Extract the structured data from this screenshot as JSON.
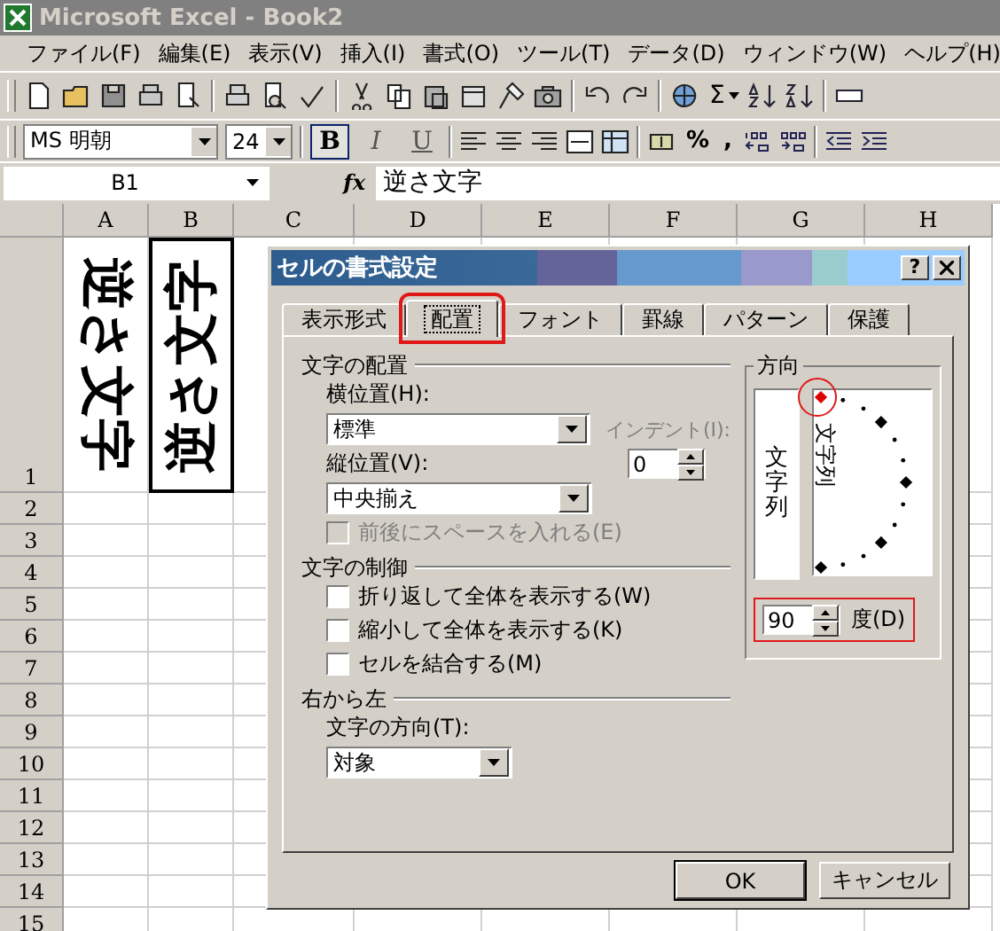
{
  "window": {
    "title": "Microsoft Excel - Book2"
  },
  "menu": [
    "ファイル(F)",
    "編集(E)",
    "表示(V)",
    "挿入(I)",
    "書式(O)",
    "ツール(T)",
    "データ(D)",
    "ウィンドウ(W)",
    "ヘルプ(H)"
  ],
  "standard_toolbar": {
    "sum_symbol": "Σ"
  },
  "format_toolbar": {
    "font_name": "MS 明朝",
    "font_size": "24",
    "style_buttons": [
      {
        "label": "B",
        "selected": true
      },
      {
        "label": "I",
        "selected": false
      },
      {
        "label": "U",
        "selected": false
      }
    ],
    "symbols": [
      "%",
      ","
    ]
  },
  "formula_bar": {
    "name_box": "B1",
    "fx": "fx",
    "formula": "逆さ文字"
  },
  "sheet": {
    "columns": [
      "A",
      "B",
      "C",
      "D",
      "E",
      "F",
      "G",
      "H"
    ],
    "rows": [
      {
        "label": "1",
        "cells": [
          {
            "text": "逆さ文字",
            "kind": "down",
            "selected": false
          },
          {
            "text": "逆さ文字",
            "kind": "up",
            "selected": true
          }
        ]
      },
      {
        "label": "2"
      },
      {
        "label": "3"
      },
      {
        "label": "4"
      },
      {
        "label": "5"
      },
      {
        "label": "6"
      },
      {
        "label": "7"
      },
      {
        "label": "8"
      },
      {
        "label": "9"
      },
      {
        "label": "10"
      },
      {
        "label": "11"
      },
      {
        "label": "12"
      },
      {
        "label": "13"
      },
      {
        "label": "14"
      },
      {
        "label": "15"
      }
    ]
  },
  "dialog": {
    "title": "セルの書式設定",
    "help": "?",
    "tabs": [
      {
        "label": "表示形式",
        "selected": false,
        "highlighted": false
      },
      {
        "label": "配置",
        "selected": true,
        "highlighted": true
      },
      {
        "label": "フォント",
        "selected": false,
        "highlighted": false
      },
      {
        "label": "罫線",
        "selected": false,
        "highlighted": false
      },
      {
        "label": "パターン",
        "selected": false,
        "highlighted": false
      },
      {
        "label": "保護",
        "selected": false,
        "highlighted": false
      }
    ],
    "alignment": {
      "heading": "文字の配置",
      "horizontal_label": "横位置(H):",
      "horizontal_value": "標準",
      "indent_label": "インデント(I):",
      "indent_disabled": true,
      "indent_value": "0",
      "vertical_label": "縦位置(V):",
      "vertical_value": "中央揃え",
      "spacing": {
        "label": "前後にスペースを入れる(E)",
        "checked": false,
        "disabled": true
      }
    },
    "text_control": {
      "heading": "文字の制御",
      "checkboxes": [
        {
          "label": "折り返して全体を表示する(W)",
          "checked": false,
          "disabled": false
        },
        {
          "label": "縮小して全体を表示する(K)",
          "checked": false,
          "disabled": false
        },
        {
          "label": "セルを結合する(M)",
          "checked": false,
          "disabled": false
        }
      ]
    },
    "rtl": {
      "heading": "右から左",
      "direction_label": "文字の方向(T):",
      "direction_value": "対象"
    },
    "orientation": {
      "heading": "方向",
      "vertical_text": "文字列",
      "dial_text": "文字列",
      "dial_highlighted": true,
      "degrees": "90",
      "degrees_label": "度(D)",
      "degrees_highlighted": true
    },
    "buttons": [
      {
        "label": "OK",
        "default": true
      },
      {
        "label": "キャンセル",
        "default": false
      }
    ]
  }
}
